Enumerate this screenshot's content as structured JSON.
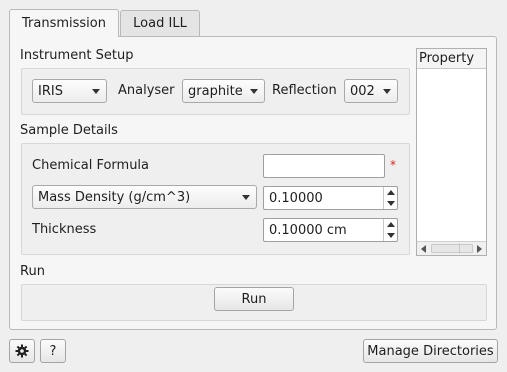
{
  "tabs": [
    {
      "label": "Transmission",
      "active": true
    },
    {
      "label": "Load ILL",
      "active": false
    }
  ],
  "instrument_setup": {
    "title": "Instrument Setup",
    "instrument_value": "IRIS",
    "analyser_label": "Analyser",
    "analyser_value": "graphite",
    "reflection_label": "Reflection",
    "reflection_value": "002"
  },
  "sample_details": {
    "title": "Sample Details",
    "chemical_formula_label": "Chemical Formula",
    "chemical_formula_value": "",
    "required_marker": "*",
    "density_type_value": "Mass Density (g/cm^3)",
    "density_value": "0.10000",
    "thickness_label": "Thickness",
    "thickness_value": "0.10000 cm"
  },
  "run": {
    "title": "Run",
    "button_label": "Run"
  },
  "property_panel": {
    "header": "Property"
  },
  "footer": {
    "settings_icon": "gear-icon",
    "help_label": "?",
    "manage_directories_label": "Manage Directories"
  }
}
